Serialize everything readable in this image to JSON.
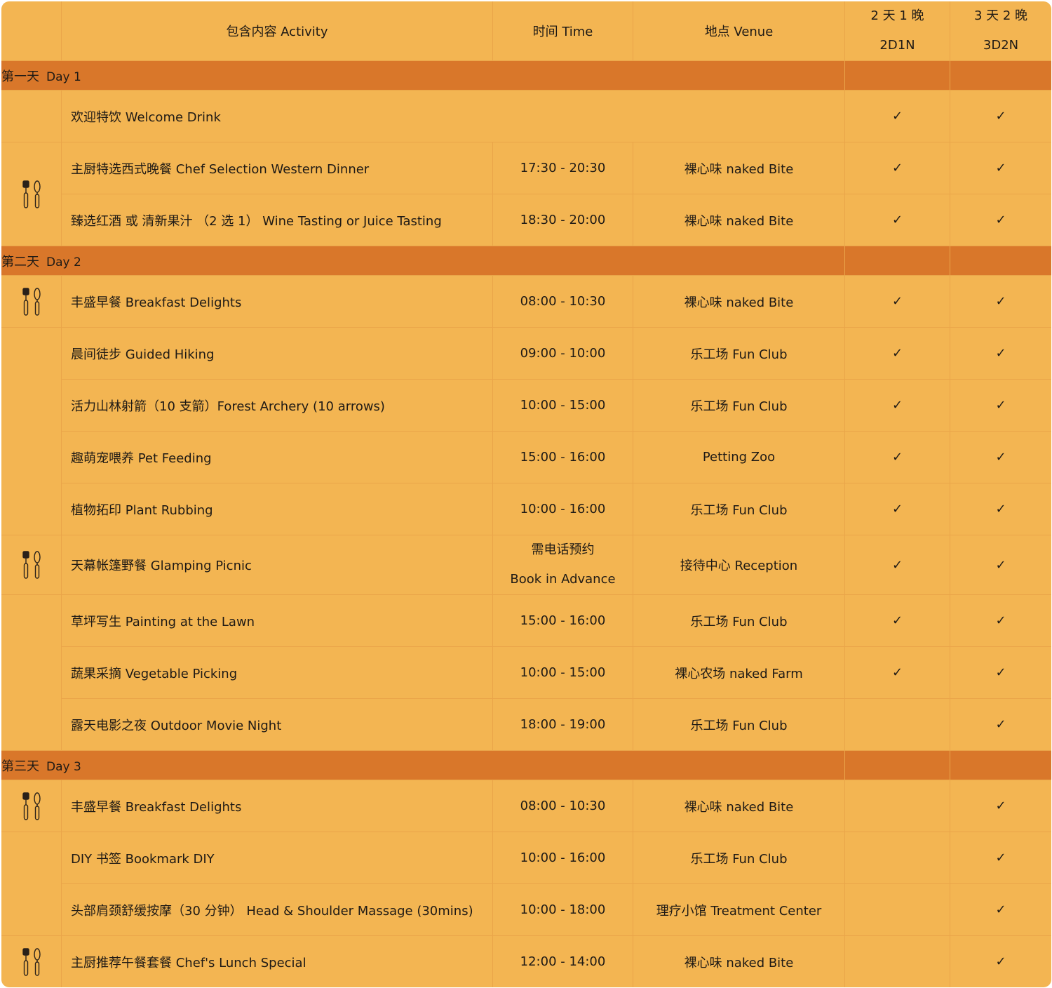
{
  "header": {
    "activity": "包含内容 Activity",
    "time": "时间 Time",
    "venue": "地点 Venue",
    "pkg1_zh": "2 天 1 晚",
    "pkg1_en": "2D1N",
    "pkg2_zh": "3 天 2 晚",
    "pkg2_en": "3D2N"
  },
  "check_symbol": "✓",
  "day1": {
    "label_zh": "第一天",
    "label_en": "Day 1",
    "rows": [
      {
        "activity": "欢迎特饮  Welcome Drink",
        "time": "",
        "venue": "",
        "pkg1": "✓",
        "pkg2": "✓",
        "icon": ""
      },
      {
        "activity": "主厨特选西式晚餐 Chef Selection Western Dinner",
        "time": "17:30 - 20:30",
        "venue": "裸心味  naked Bite",
        "pkg1": "✓",
        "pkg2": "✓",
        "icon": "utensils-icon"
      },
      {
        "activity": "臻选红酒  或  清新果汁  （2 选 1）   Wine Tasting or Juice Tasting",
        "time": "18:30 - 20:00",
        "venue": "裸心味  naked Bite",
        "pkg1": "✓",
        "pkg2": "✓",
        "icon": ""
      }
    ]
  },
  "day2": {
    "label_zh": "第二天",
    "label_en": "Day 2",
    "rows": [
      {
        "activity": "丰盛早餐  Breakfast Delights",
        "time": "08:00 - 10:30",
        "venue": "裸心味  naked Bite",
        "pkg1": "✓",
        "pkg2": "✓",
        "icon": "utensils-icon"
      },
      {
        "activity": "晨间徒步  Guided Hiking",
        "time": "09:00 - 10:00",
        "venue": "乐工场  Fun Club",
        "pkg1": "✓",
        "pkg2": "✓",
        "icon": ""
      },
      {
        "activity": "活力山林射箭（10 支箭）Forest Archery (10 arrows)",
        "time": "10:00 - 15:00",
        "venue": "乐工场  Fun Club",
        "pkg1": "✓",
        "pkg2": "✓",
        "icon": ""
      },
      {
        "activity": "趣萌宠喂养  Pet Feeding",
        "time": "15:00 - 16:00",
        "venue": "Petting Zoo",
        "pkg1": "✓",
        "pkg2": "✓",
        "icon": ""
      },
      {
        "activity": "植物拓印  Plant Rubbing",
        "time": "10:00 - 16:00",
        "venue": "乐工场  Fun Club",
        "pkg1": "✓",
        "pkg2": "✓",
        "icon": ""
      },
      {
        "activity": "天幕帐篷野餐  Glamping Picnic",
        "time_line1": "需电话预约",
        "time_line2": "Book in Advance",
        "venue": "接待中心 Reception",
        "pkg1": "✓",
        "pkg2": "✓",
        "icon": "utensils-icon"
      },
      {
        "activity": "草坪写生  Painting at the Lawn",
        "time": "15:00 - 16:00",
        "venue": "乐工场  Fun Club",
        "pkg1": "✓",
        "pkg2": "✓",
        "icon": ""
      },
      {
        "activity": "蔬果采摘  Vegetable Picking",
        "time": "10:00 - 15:00",
        "venue": "裸心农场  naked Farm",
        "pkg1": "✓",
        "pkg2": "✓",
        "icon": ""
      },
      {
        "activity": "露天电影之夜  Outdoor Movie Night",
        "time": "18:00 - 19:00",
        "venue": "乐工场 Fun Club",
        "pkg1": "",
        "pkg2": "✓",
        "icon": ""
      }
    ]
  },
  "day3": {
    "label_zh": "第三天",
    "label_en": "Day 3",
    "rows": [
      {
        "activity": "丰盛早餐  Breakfast Delights",
        "time": "08:00 - 10:30",
        "venue": "裸心味  naked Bite",
        "pkg1": "",
        "pkg2": "✓",
        "icon": "utensils-icon"
      },
      {
        "activity": "DIY 书签  Bookmark DIY",
        "time": "10:00 - 16:00",
        "venue": "乐工场  Fun Club",
        "pkg1": "",
        "pkg2": "✓",
        "icon": ""
      },
      {
        "activity": "头部肩颈舒缓按摩（30 分钟）   Head & Shoulder Massage (30mins)",
        "time": "10:00 - 18:00",
        "venue": "理疗小馆  Treatment Center",
        "pkg1": "",
        "pkg2": "✓",
        "icon": ""
      },
      {
        "activity": "主厨推荐午餐套餐  Chef's Lunch Special",
        "time": "12:00 - 14:00",
        "venue": "裸心味  naked Bite",
        "pkg1": "",
        "pkg2": "✓",
        "icon": "utensils-icon"
      }
    ]
  }
}
